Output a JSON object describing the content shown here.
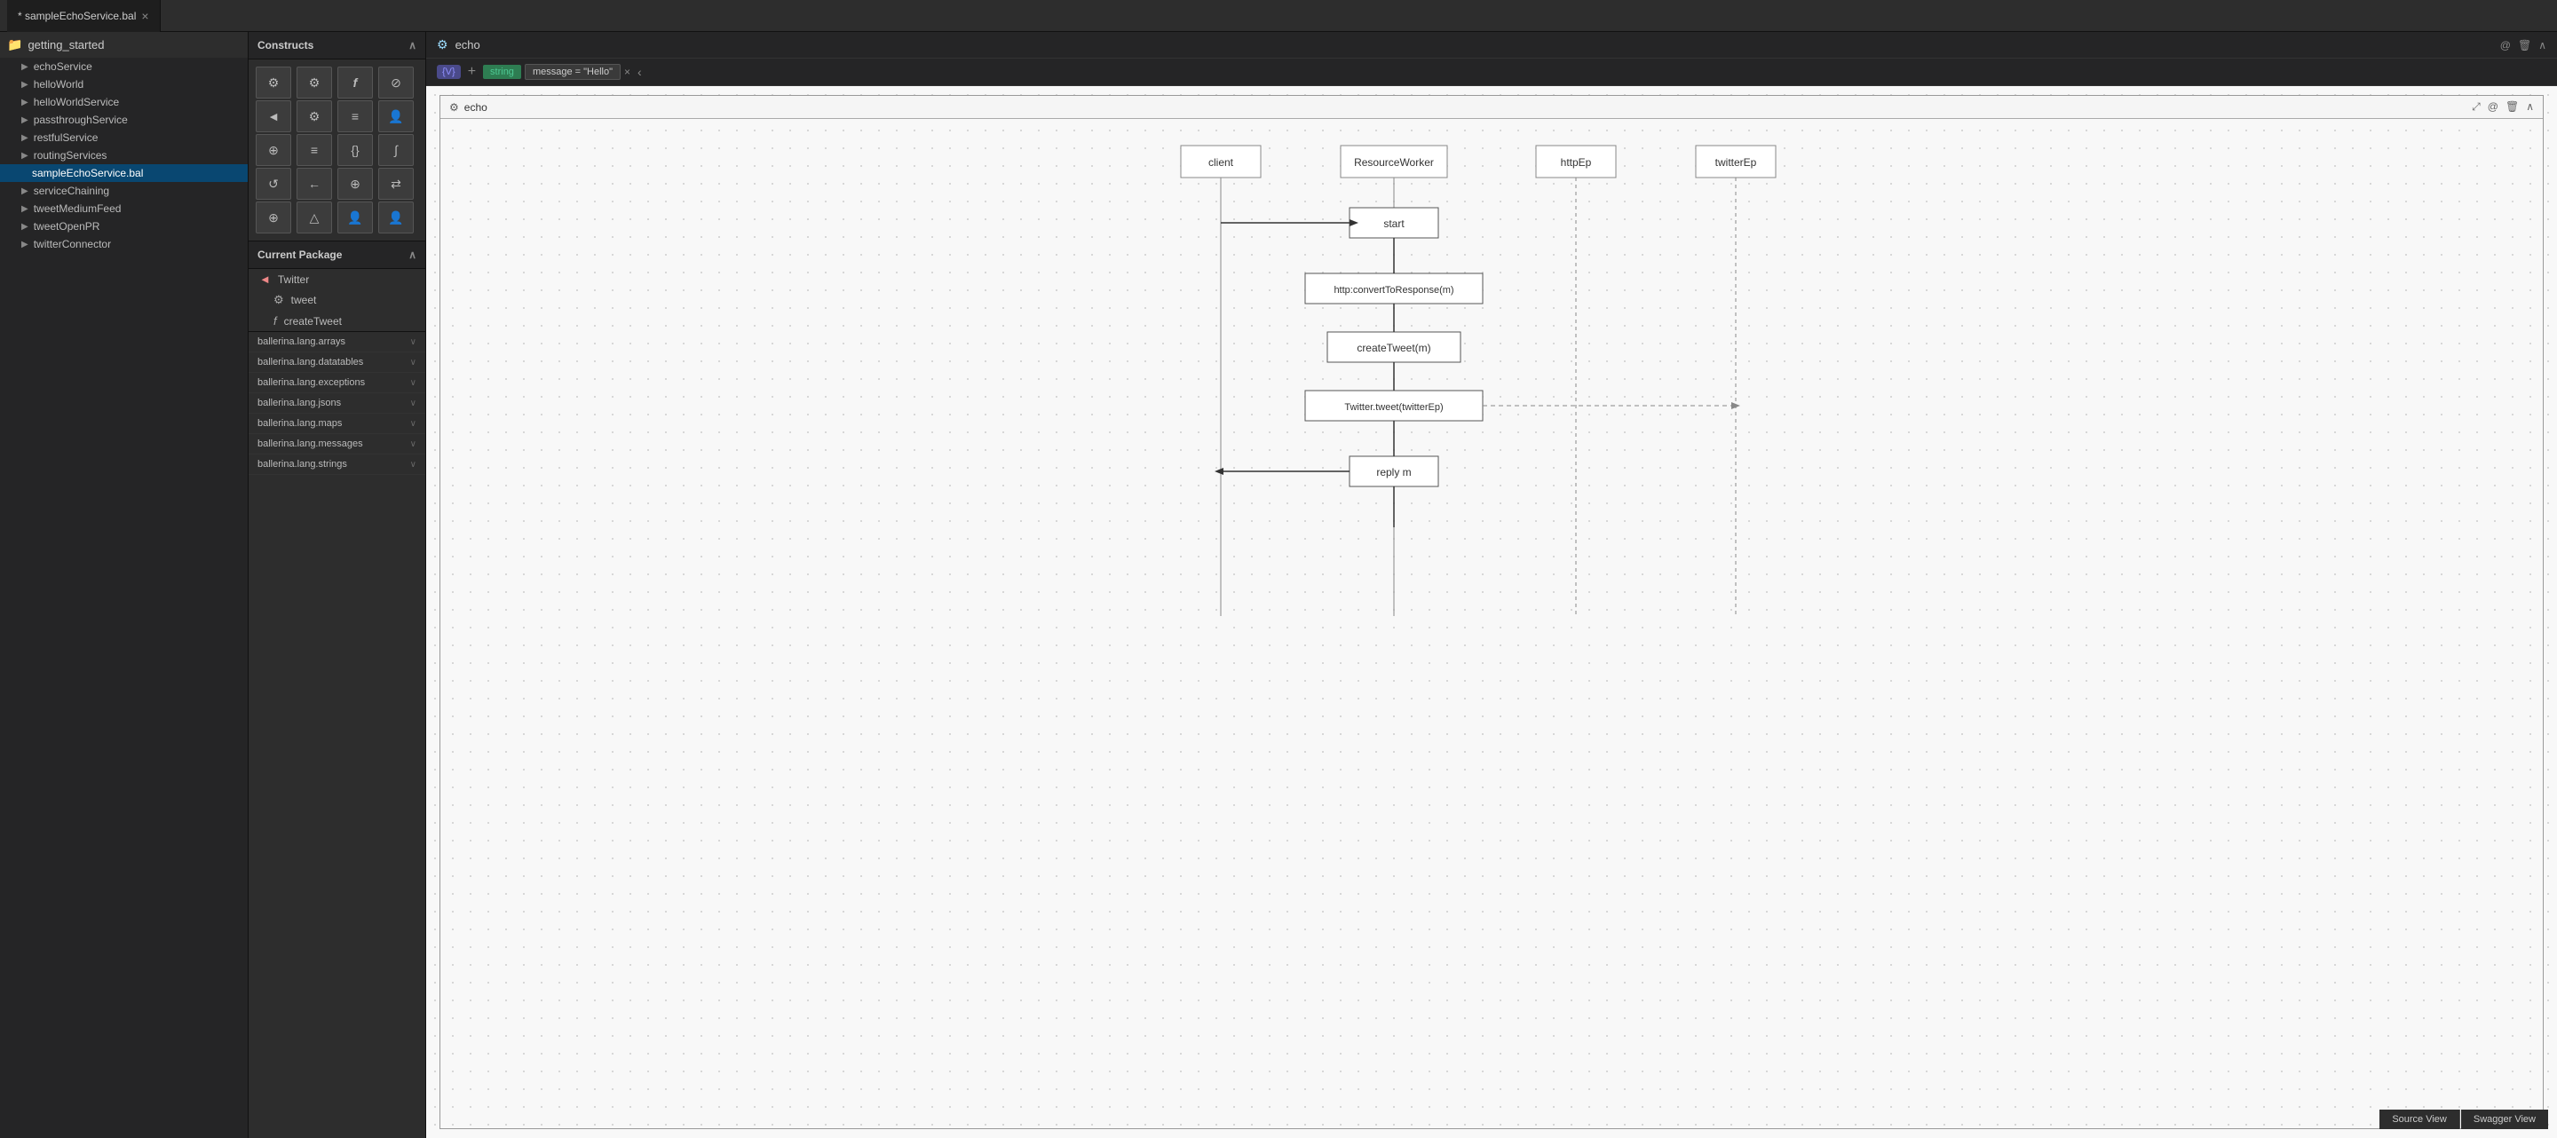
{
  "topBar": {
    "tab": "* sampleEchoService.bal",
    "closeIcon": "×"
  },
  "sidebar": {
    "rootFolder": "getting_started",
    "items": [
      {
        "label": "echoService",
        "type": "folder",
        "indent": 1
      },
      {
        "label": "helloWorld",
        "type": "folder",
        "indent": 1
      },
      {
        "label": "helloWorldService",
        "type": "folder",
        "indent": 1
      },
      {
        "label": "passthroughService",
        "type": "folder",
        "indent": 1
      },
      {
        "label": "restfulService",
        "type": "folder",
        "indent": 1
      },
      {
        "label": "routingServices",
        "type": "folder",
        "indent": 1
      },
      {
        "label": "sampleEchoService.bal",
        "type": "file",
        "indent": 2,
        "selected": true
      },
      {
        "label": "serviceChaining",
        "type": "folder",
        "indent": 1
      },
      {
        "label": "tweetMediumFeed",
        "type": "folder",
        "indent": 1
      },
      {
        "label": "tweetOpenPR",
        "type": "folder",
        "indent": 1
      },
      {
        "label": "twitterConnector",
        "type": "folder",
        "indent": 1
      }
    ]
  },
  "constructs": {
    "title": "Constructs",
    "buttons": [
      {
        "icon": "⚙",
        "name": "service"
      },
      {
        "icon": "⚙",
        "name": "resource"
      },
      {
        "icon": "ƒ",
        "name": "function"
      },
      {
        "icon": "⊘",
        "name": "connector"
      },
      {
        "icon": "◄",
        "name": "action"
      },
      {
        "icon": "⚙",
        "name": "worker"
      },
      {
        "icon": "≡",
        "name": "struct"
      },
      {
        "icon": "👤",
        "name": "annotation"
      },
      {
        "icon": "⊕",
        "name": "variable"
      },
      {
        "icon": "≡",
        "name": "transform"
      },
      {
        "icon": "{}",
        "name": "enum"
      },
      {
        "icon": "∫",
        "name": "type-mapper"
      },
      {
        "icon": "↺",
        "name": "return"
      },
      {
        "icon": "←",
        "name": "reply"
      },
      {
        "icon": "⊕",
        "name": "invoke"
      },
      {
        "icon": "⇄",
        "name": "parallel"
      },
      {
        "icon": "⊕",
        "name": "fork"
      },
      {
        "icon": "△",
        "name": "alert"
      },
      {
        "icon": "👤",
        "name": "role"
      },
      {
        "icon": "👤",
        "name": "endpoint"
      }
    ]
  },
  "currentPackage": {
    "title": "Current Package",
    "items": [
      {
        "icon": "◄",
        "label": "Twitter",
        "type": "connector"
      },
      {
        "icon": "⚙",
        "label": "tweet",
        "type": "resource"
      },
      {
        "icon": "ƒ",
        "label": "createTweet",
        "type": "function"
      }
    ]
  },
  "dependencies": [
    {
      "label": "ballerina.lang.arrays"
    },
    {
      "label": "ballerina.lang.datatables"
    },
    {
      "label": "ballerina.lang.exceptions"
    },
    {
      "label": "ballerina.lang.jsons"
    },
    {
      "label": "ballerina.lang.maps"
    },
    {
      "label": "ballerina.lang.messages"
    },
    {
      "label": "ballerina.lang.strings"
    }
  ],
  "editor": {
    "functionName": "echo",
    "params": {
      "varsBadge": "{V}",
      "addBtn": "+",
      "paramType": "string",
      "paramValue": "message = \"Hello\"",
      "closeIcon": "×"
    },
    "innerFunction": {
      "name": "echo",
      "gearIcon": "⚙"
    },
    "diagram": {
      "nodes": {
        "client": "client",
        "resourceWorker": "ResourceWorker",
        "httpEp": "httpEp",
        "twitterEp": "twitterEp",
        "start": "start",
        "httpConvert": "http:convertToResponse(m)",
        "createTweet": "createTweet(m)",
        "twitterTweet": "Twitter.tweet(twitterEp)",
        "replyM": "reply m"
      }
    },
    "viewButtons": [
      {
        "label": "Source View"
      },
      {
        "label": "Swagger View"
      }
    ]
  }
}
